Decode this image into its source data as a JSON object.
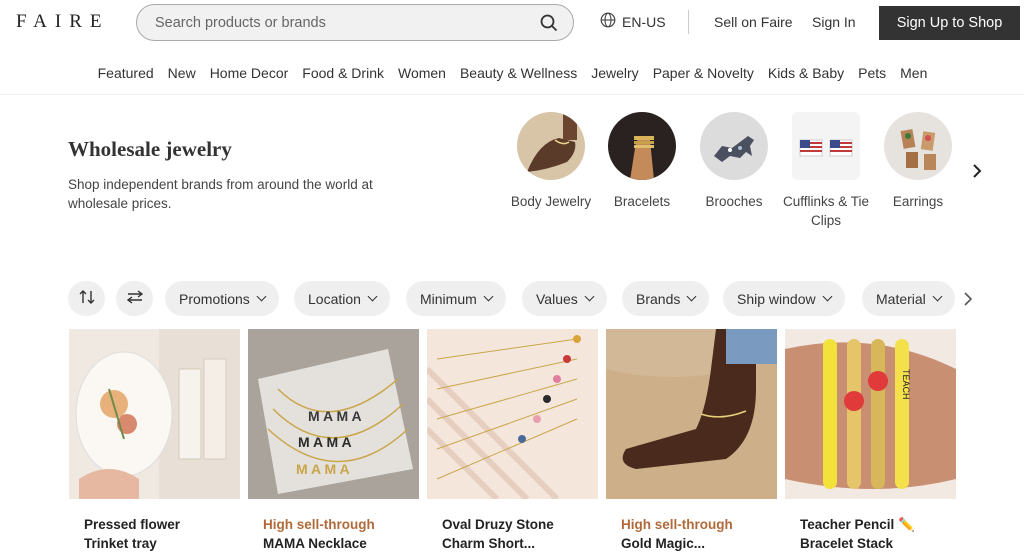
{
  "header": {
    "logo": "FAIRE",
    "search_placeholder": "Search products or brands",
    "language": "EN-US",
    "sell_label": "Sell on Faire",
    "signin_label": "Sign In",
    "signup_label": "Sign Up to Shop"
  },
  "nav": {
    "categories": [
      "Featured",
      "New",
      "Home Decor",
      "Food & Drink",
      "Women",
      "Beauty & Wellness",
      "Jewelry",
      "Paper & Novelty",
      "Kids & Baby",
      "Pets",
      "Men"
    ]
  },
  "hero": {
    "title": "Wholesale jewelry",
    "subtitle": "Shop independent brands from around the world at wholesale prices."
  },
  "subcategories": [
    {
      "label": "Body Jewelry",
      "icon": "anklet-photo"
    },
    {
      "label": "Bracelets",
      "icon": "bracelet-photo"
    },
    {
      "label": "Brooches",
      "icon": "horse-brooch-photo"
    },
    {
      "label": "Cufflinks & Tie Clips",
      "icon": "flag-cufflinks-photo"
    },
    {
      "label": "Earrings",
      "icon": "earrings-photo"
    }
  ],
  "filters": {
    "sort_icon": "sort-arrows-icon",
    "adjust_icon": "sliders-icon",
    "items": [
      "Promotions",
      "Location",
      "Minimum",
      "Values",
      "Brands",
      "Ship window",
      "Material"
    ]
  },
  "products": [
    {
      "badge": "",
      "name": "Pressed flower",
      "name2": "Trinket tray"
    },
    {
      "badge": "High sell-through",
      "name": "MAMA Necklace",
      "name2": ""
    },
    {
      "badge": "",
      "name": "Oval Druzy Stone",
      "name2": "Charm Short..."
    },
    {
      "badge": "High sell-through",
      "name": "Gold Magic...",
      "name2": ""
    },
    {
      "badge": "",
      "name": "Teacher Pencil ✏️",
      "name2": "Bracelet Stack"
    }
  ],
  "colors": {
    "badge": "#b06a3a",
    "signup_bg": "#333333",
    "pill_bg": "#efefef"
  }
}
